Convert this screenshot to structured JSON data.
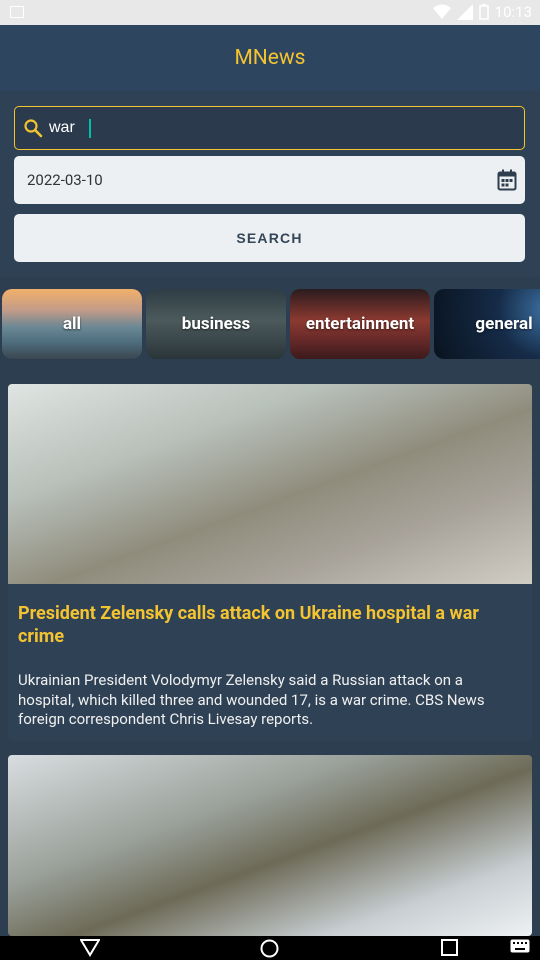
{
  "status_bar": {
    "time": "10:13"
  },
  "app": {
    "title": "MNews"
  },
  "search": {
    "value": "war"
  },
  "date": {
    "value": "2022-03-10"
  },
  "search_button": {
    "label": "SEARCH"
  },
  "categories": [
    {
      "label": "all"
    },
    {
      "label": "business"
    },
    {
      "label": "entertainment"
    },
    {
      "label": "general"
    }
  ],
  "articles": [
    {
      "title": "President Zelensky calls attack on Ukraine hospital a war crime",
      "description": "Ukrainian President Volodymyr Zelensky said a Russian attack on a hospital, which killed three and wounded 17, is a war crime. CBS News foreign correspondent Chris Livesay reports."
    },
    {
      "title": "",
      "description": ""
    }
  ],
  "colors": {
    "accent": "#f4c430",
    "background": "#2c3e50"
  },
  "icons": [
    "search-icon",
    "calendar-icon",
    "back-icon",
    "home-icon",
    "recents-icon",
    "keyboard-icon"
  ]
}
